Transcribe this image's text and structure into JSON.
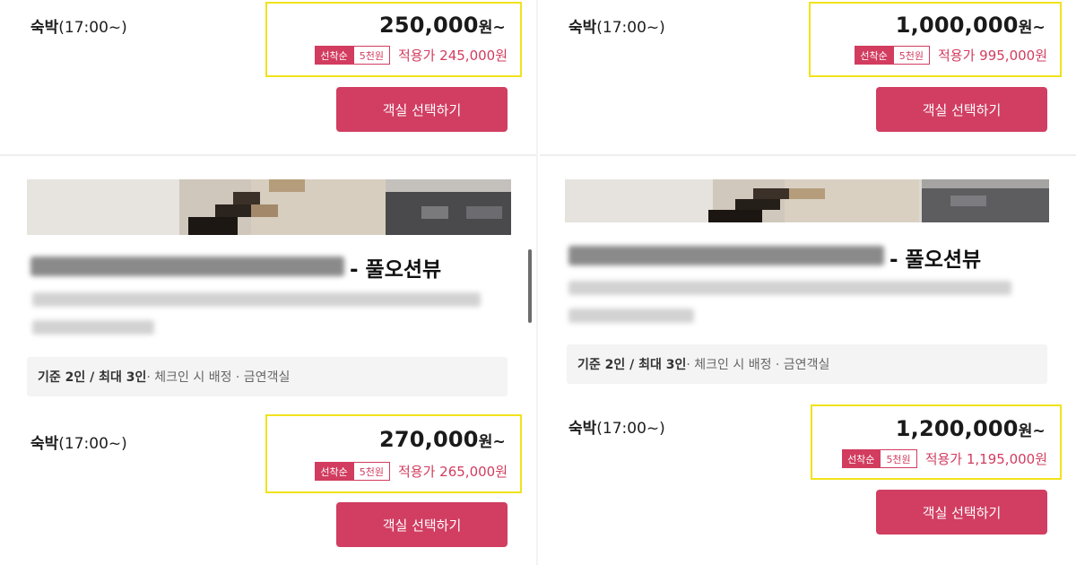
{
  "cards": {
    "top_left": {
      "stay_label": "숙박",
      "stay_time": "(17:00~)",
      "price": "250,000",
      "price_unit": "원~",
      "coupon_badge": "선착순",
      "coupon_amount": "5천원",
      "apply_label": "적용가 245,000원",
      "button_label": "객실 선택하기"
    },
    "top_right": {
      "stay_label": "숙박",
      "stay_time": "(17:00~)",
      "price": "1,000,000",
      "price_unit": "원~",
      "coupon_badge": "선착순",
      "coupon_amount": "5천원",
      "apply_label": "적용가 995,000원",
      "button_label": "객실 선택하기"
    },
    "bottom_left": {
      "title_suffix": "- 풀오션뷰",
      "info_capacity": "기준 2인 / 최대 3인",
      "info_extra": " · 체크인 시 배정 · 금연객실",
      "stay_label": "숙박",
      "stay_time": "(17:00~)",
      "price": "270,000",
      "price_unit": "원~",
      "coupon_badge": "선착순",
      "coupon_amount": "5천원",
      "apply_label": "적용가 265,000원",
      "button_label": "객실 선택하기"
    },
    "bottom_right": {
      "title_suffix": "- 풀오션뷰",
      "info_capacity": "기준 2인 / 최대 3인",
      "info_extra": " · 체크인 시 배정 · 금연객실",
      "stay_label": "숙박",
      "stay_time": "(17:00~)",
      "price": "1,200,000",
      "price_unit": "원~",
      "coupon_badge": "선착순",
      "coupon_amount": "5천원",
      "apply_label": "적용가 1,195,000원",
      "button_label": "객실 선택하기"
    }
  },
  "colors": {
    "accent": "#d13e62",
    "highlight_border": "#f1e21b",
    "info_bg": "#f4f4f5"
  }
}
